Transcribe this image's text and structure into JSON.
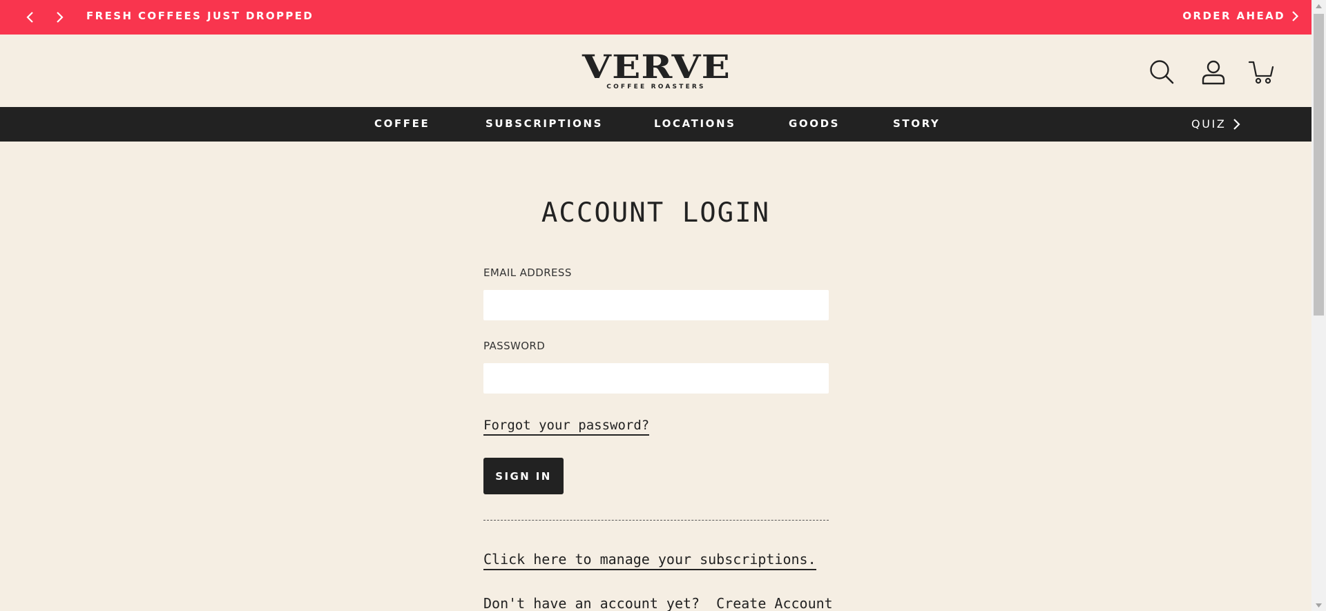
{
  "announcement": {
    "message": "FRESH COFFEES JUST DROPPED",
    "order_ahead": "ORDER AHEAD",
    "background": "#f9354e"
  },
  "header": {
    "logo_wordmark": "VERVE",
    "logo_sub": "COFFEE ROASTERS",
    "icons": [
      "search-icon",
      "account-icon",
      "cart-icon"
    ]
  },
  "nav": {
    "items": [
      "COFFEE",
      "SUBSCRIPTIONS",
      "LOCATIONS",
      "GOODS",
      "STORY"
    ],
    "quiz": "QUIZ"
  },
  "login": {
    "title": "ACCOUNT LOGIN",
    "email_label": "EMAIL ADDRESS",
    "email_value": "",
    "password_label": "PASSWORD",
    "password_value": "",
    "forgot": "Forgot your password?",
    "sign_in": "SIGN IN",
    "manage_subscriptions": "Click here to manage your subscriptions.",
    "no_account": "Don't have an account yet?",
    "create_account": "Create Account"
  }
}
